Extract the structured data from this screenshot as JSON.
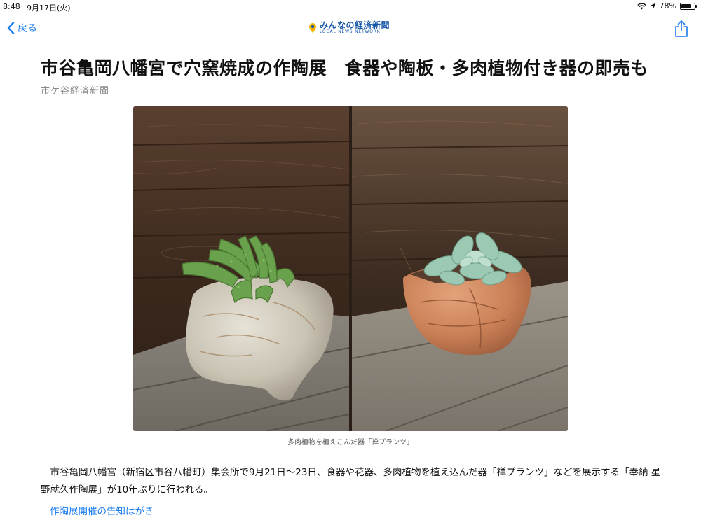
{
  "status": {
    "time": "8:48",
    "date": "9月17日(火)",
    "battery": "78%",
    "battery_level": 0.78
  },
  "nav": {
    "back_label": "戻る",
    "logo_main": "みんなの経済新聞",
    "logo_sub": "LOCAL NEWS NETWORK"
  },
  "article": {
    "title": "市谷亀岡八幡宮で穴窯焼成の作陶展　食器や陶板・多肉植物付き器の即売も",
    "source": "市ケ谷経済新聞",
    "photo_alt": "多肉植物を植えこんだ器「禅プランツ」",
    "caption": "多肉植物を植えこんだ器「禅プランツ」",
    "body": "　市谷亀岡八幡宮（新宿区市谷八幡町）集会所で9月21日～23日、食器や花器、多肉植物を植え込んだ器「禅プランツ」などを展示する「奉納 星野就久作陶展」が10年ぶりに行われる。",
    "related_link": "作陶展開催の告知はがき"
  },
  "colors": {
    "accent": "#1a7cf0",
    "logo": "#1556a6",
    "source_gray": "#8a8a8a"
  },
  "icons": [
    "chevron-left-icon",
    "logo-icon",
    "share-icon",
    "wifi-icon",
    "location-icon",
    "battery-icon"
  ]
}
